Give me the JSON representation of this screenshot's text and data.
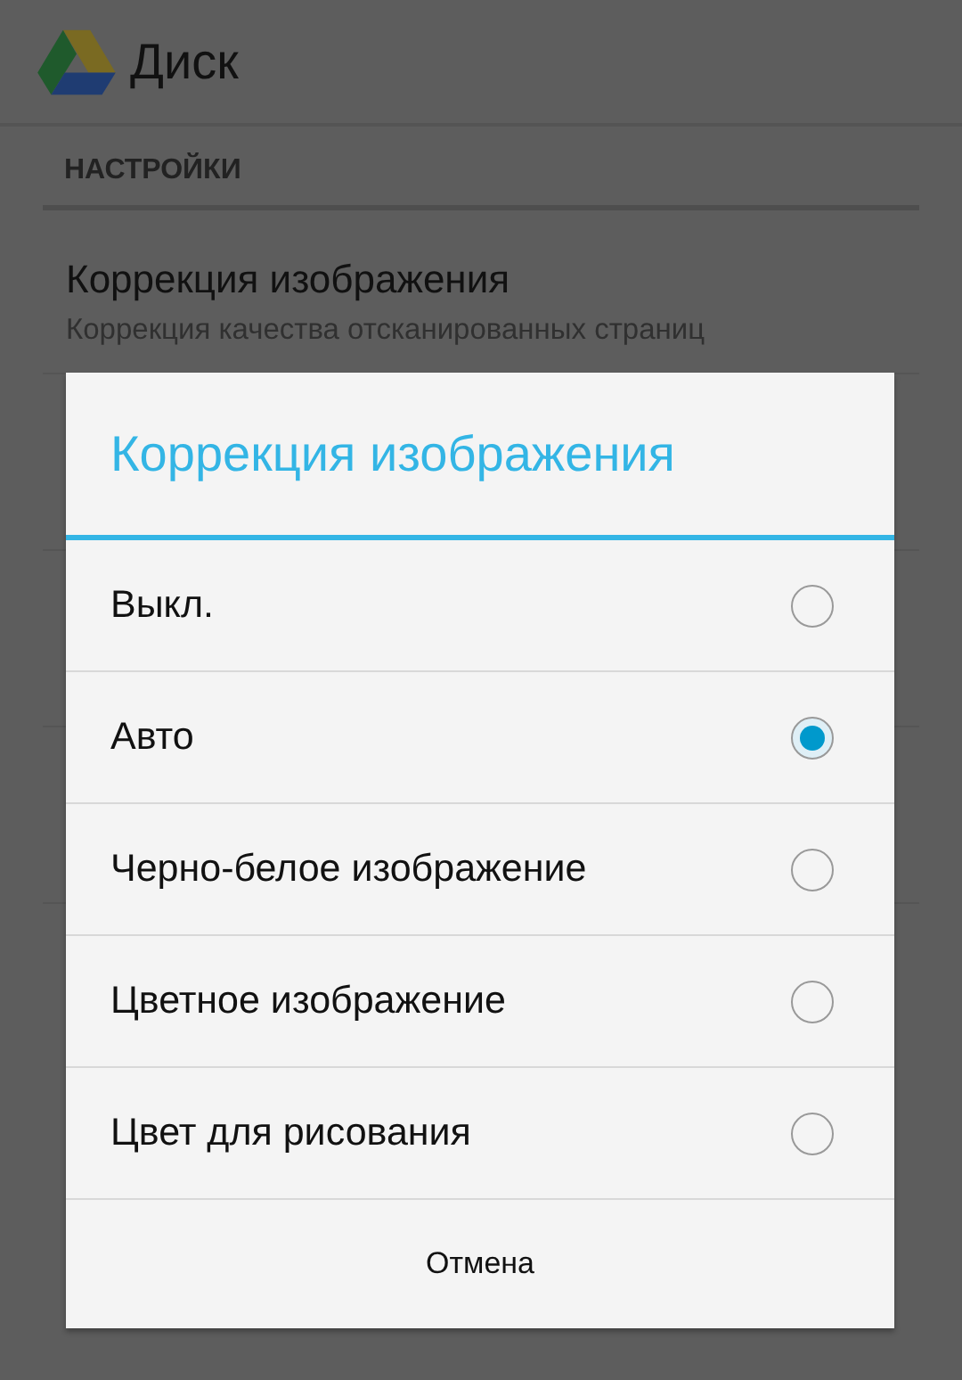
{
  "app_bar": {
    "title": "Диск"
  },
  "settings": {
    "section_header": "НАСТРОЙКИ",
    "items": [
      {
        "title": "Коррекция изображения",
        "summary": "Коррекция качества отсканированных страниц"
      }
    ]
  },
  "dialog": {
    "title": "Коррекция изображения",
    "options": [
      {
        "label": "Выкл.",
        "selected": false
      },
      {
        "label": "Авто",
        "selected": true
      },
      {
        "label": "Черно-белое изображение",
        "selected": false
      },
      {
        "label": "Цветное изображение",
        "selected": false
      },
      {
        "label": "Цвет для рисования",
        "selected": false
      }
    ],
    "cancel": "Отмена"
  }
}
